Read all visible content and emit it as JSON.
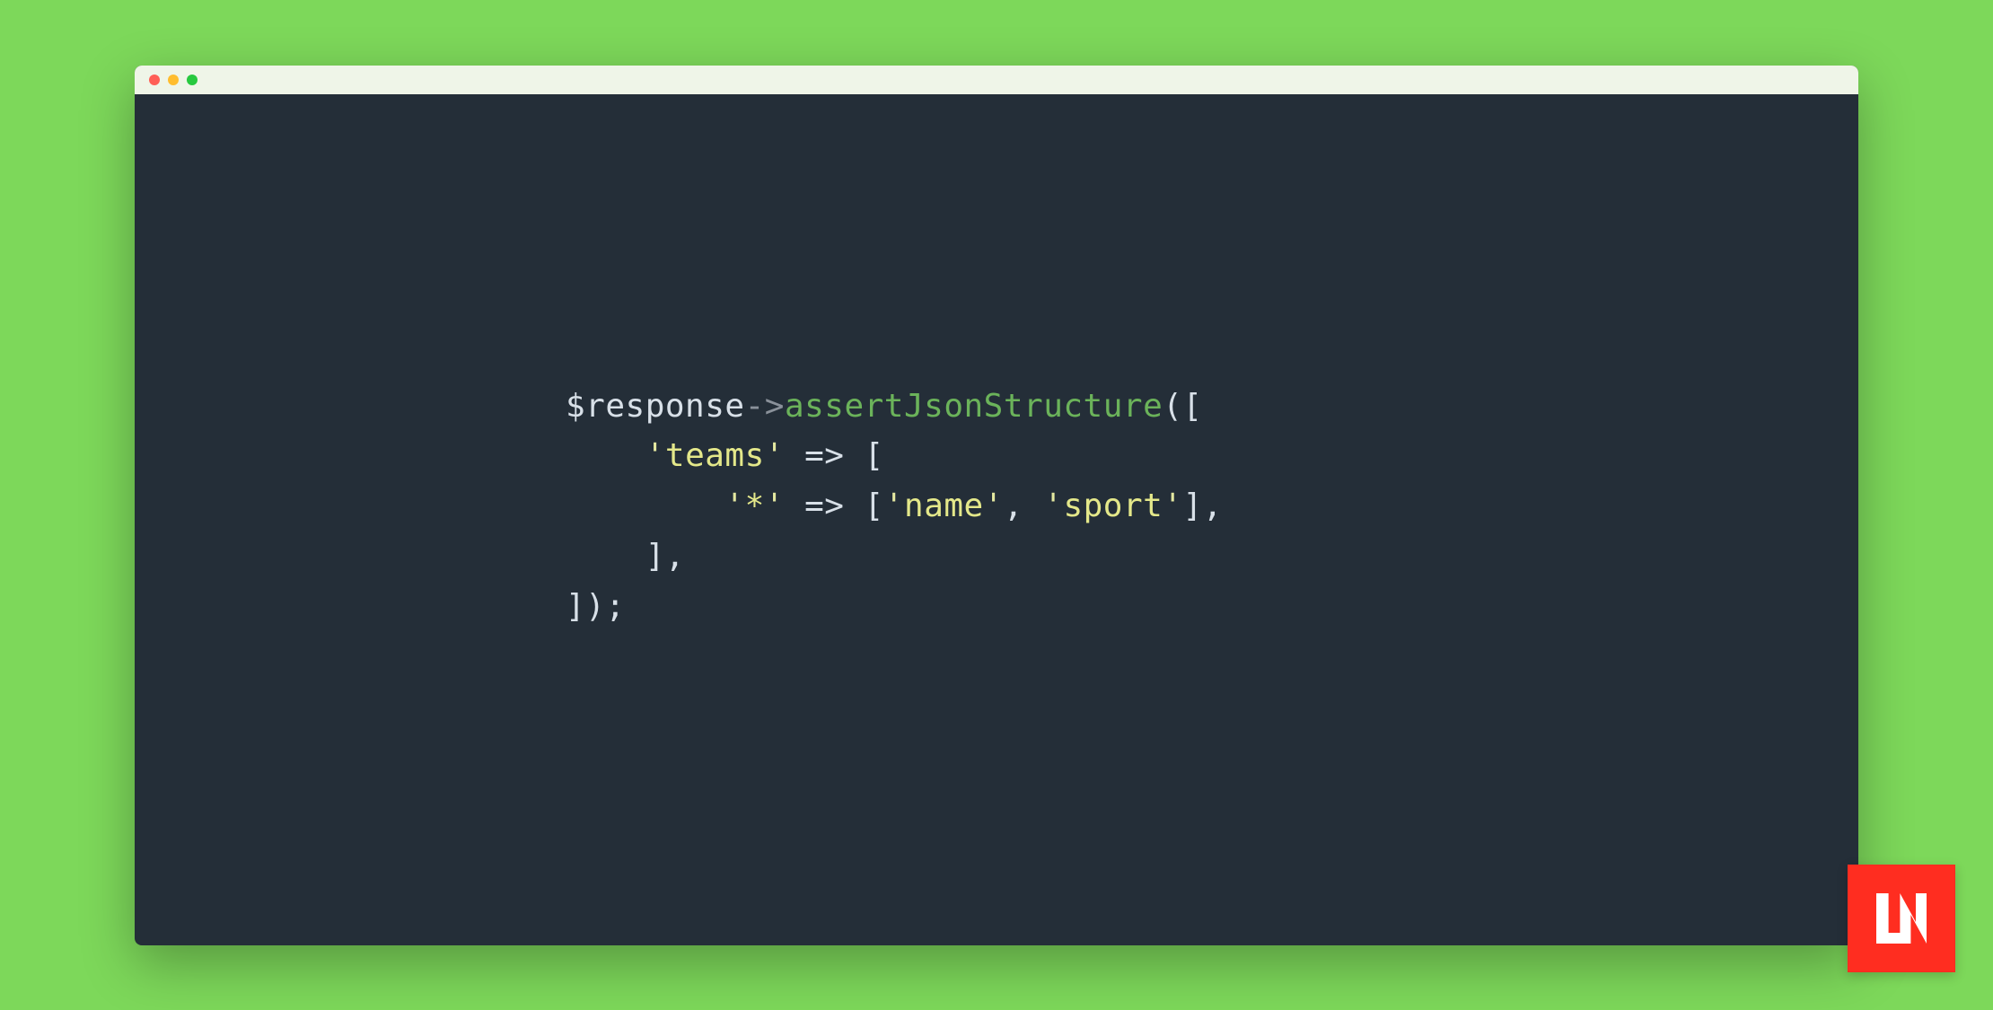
{
  "code": {
    "line1": {
      "variable": "$response",
      "arrow": "->",
      "method": "assertJsonStructure",
      "open": "(["
    },
    "line2": {
      "indent": "    ",
      "quote1": "'",
      "key": "teams",
      "quote2": "'",
      "arrow": " => [",
      "close": ""
    },
    "line3": {
      "indent": "        ",
      "quote1": "'",
      "key": "*",
      "quote2": "'",
      "arrow": " => [",
      "q3": "'",
      "val1": "name",
      "q4": "'",
      "comma1": ", ",
      "q5": "'",
      "val2": "sport",
      "q6": "'",
      "close": "],"
    },
    "line4": {
      "indent": "    ",
      "close": "],"
    },
    "line5": {
      "close": "]);"
    }
  },
  "logo": {
    "text": "LN"
  }
}
